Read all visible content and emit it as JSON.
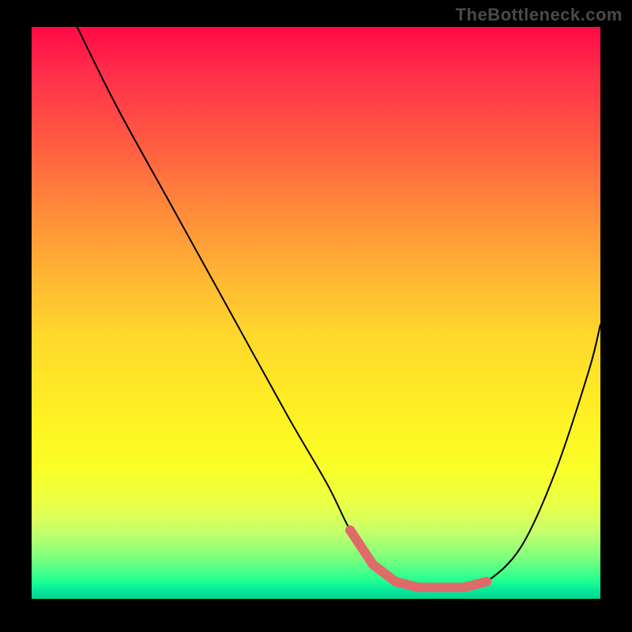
{
  "watermark": "TheBottleneck.com",
  "chart_data": {
    "type": "line",
    "title": "",
    "xlabel": "",
    "ylabel": "",
    "xlim": [
      0,
      100
    ],
    "ylim": [
      0,
      100
    ],
    "x": [
      8,
      15,
      25,
      35,
      45,
      52,
      56,
      60,
      64,
      68,
      72,
      76,
      80,
      86,
      92,
      98,
      100
    ],
    "values": [
      100,
      86,
      68,
      50,
      32,
      20,
      12,
      6,
      3,
      2,
      2,
      2,
      3,
      9,
      22,
      40,
      48
    ],
    "highlight": {
      "x": [
        56,
        60,
        64,
        68,
        72,
        76,
        80
      ],
      "values": [
        12,
        6,
        3,
        2,
        2,
        2,
        3
      ]
    },
    "gradient_stops": [
      {
        "pos": 0,
        "color": "#ff0a46"
      },
      {
        "pos": 0.5,
        "color": "#ffd82d"
      },
      {
        "pos": 0.85,
        "color": "#e8ff4a"
      },
      {
        "pos": 1.0,
        "color": "#02d58f"
      }
    ]
  }
}
